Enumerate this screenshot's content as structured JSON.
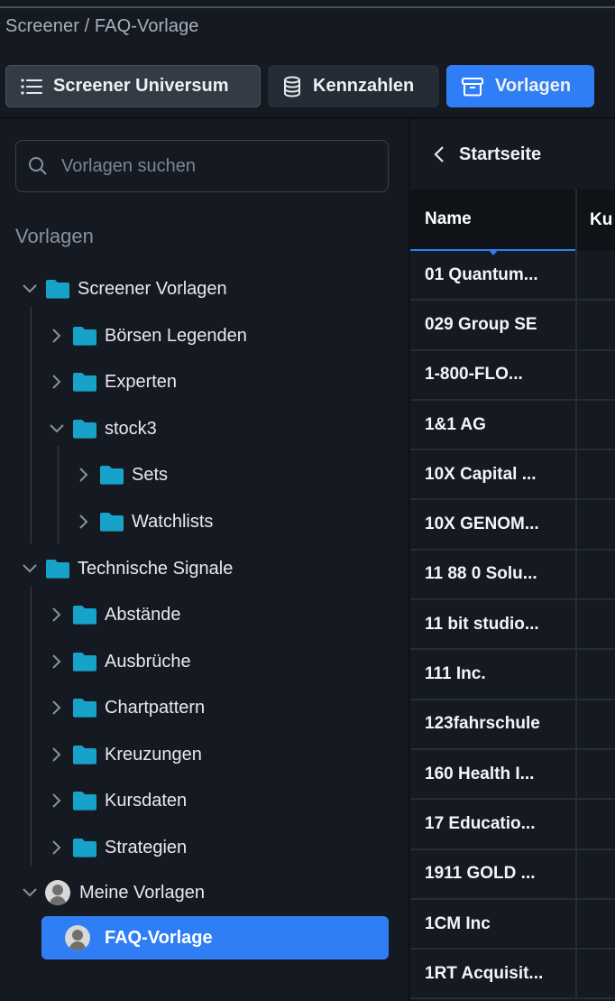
{
  "breadcrumb": "Screener / FAQ-Vorlage",
  "toolbar": {
    "universe_label": "Screener Universum",
    "kennzahlen_label": "Kennzahlen",
    "vorlagen_label": "Vorlagen"
  },
  "search": {
    "placeholder": "Vorlagen suchen"
  },
  "sidebar": {
    "section_title": "Vorlagen",
    "tree": {
      "screener_vorlagen": "Screener Vorlagen",
      "boersen_legenden": "Börsen Legenden",
      "experten": "Experten",
      "stock3": "stock3",
      "sets": "Sets",
      "watchlists": "Watchlists",
      "technische_signale": "Technische Signale",
      "abstaende": "Abstände",
      "ausbrueche": "Ausbrüche",
      "chartpattern": "Chartpattern",
      "kreuzungen": "Kreuzungen",
      "kursdaten": "Kursdaten",
      "strategien": "Strategien",
      "meine_vorlagen": "Meine Vorlagen",
      "faq_vorlage": "FAQ-Vorlage"
    }
  },
  "right_panel": {
    "back_label": "Startseite",
    "columns": [
      "Name",
      "Ku"
    ],
    "rows": [
      "01 Quantum...",
      "029 Group SE",
      "1-800-FLO...",
      "1&1 AG",
      "10X Capital ...",
      "10X GENOM...",
      "11 88 0 Solu...",
      "11 bit studio...",
      "111 Inc.",
      "123fahrschule",
      "160 Health I...",
      "17 Educatio...",
      "1911 GOLD ...",
      "1CM Inc",
      "1RT Acquisit..."
    ]
  },
  "colors": {
    "accent": "#2f7ef5",
    "folder": "#17a3c9",
    "background": "#151a22"
  }
}
